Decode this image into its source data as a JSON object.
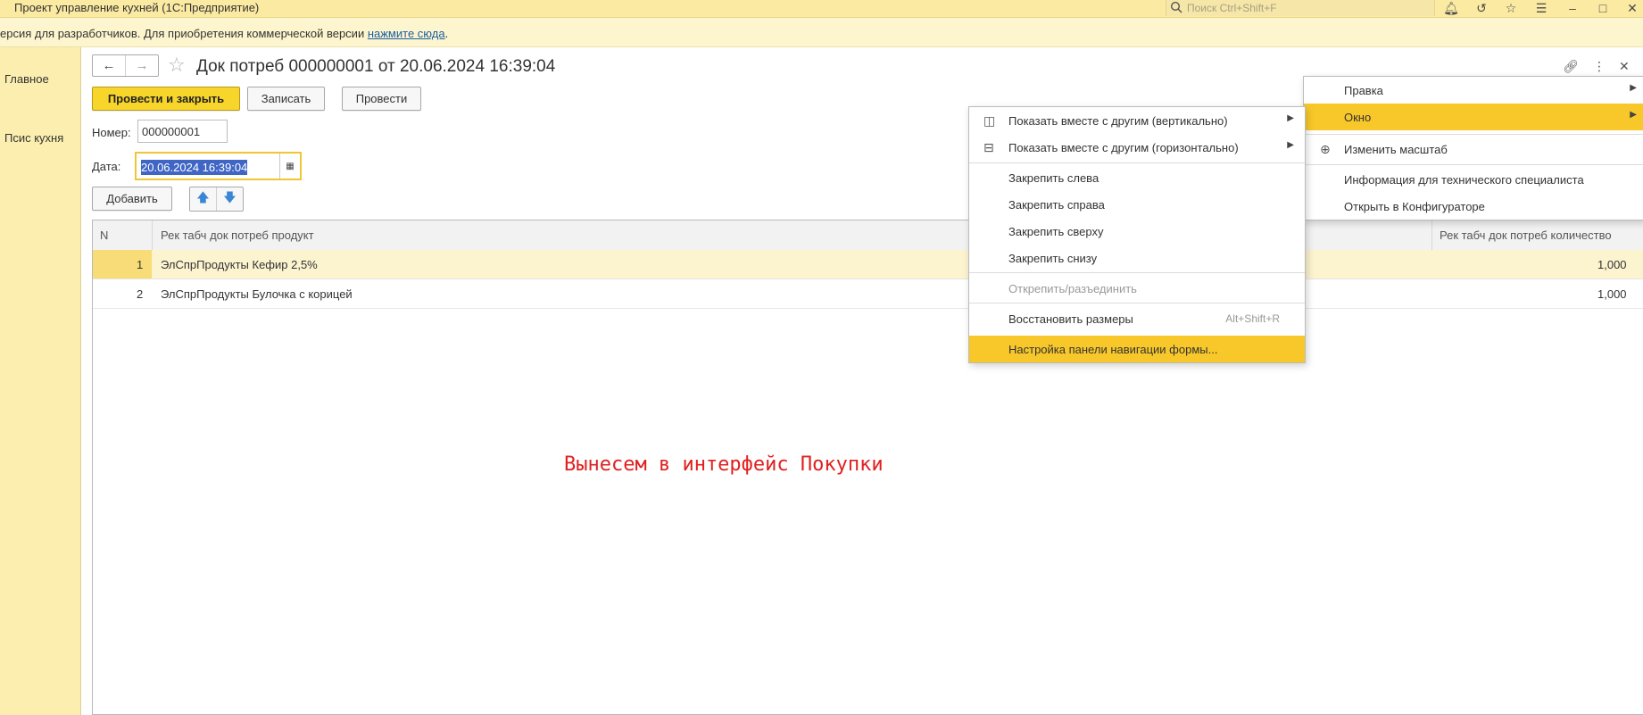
{
  "app": {
    "title": "Проект управление кухней  (1С:Предприятие)",
    "search_placeholder": "Поиск Ctrl+Shift+F"
  },
  "infobar": {
    "text": "ерсия для разработчиков. Для приобретения коммерческой версии ",
    "link": "нажмите сюда",
    "suffix": "."
  },
  "leftnav": {
    "items": [
      "Главное",
      "Псис кухня"
    ]
  },
  "form": {
    "title": "Док потреб 000000001 от 20.06.2024 16:39:04",
    "buttons": {
      "post_close": "Провести и закрыть",
      "save": "Записать",
      "post": "Провести",
      "add": "Добавить"
    },
    "number_label": "Номер:",
    "number_value": "000000001",
    "date_label": "Дата:",
    "date_value": "20.06.2024 16:39:04"
  },
  "table": {
    "columns": [
      "N",
      "Рек табч док потреб продукт",
      "Рек табч док потреб количество"
    ],
    "rows": [
      {
        "n": "1",
        "product": "ЭлСпрПродукты Кефир 2,5%",
        "qty": "1,000"
      },
      {
        "n": "2",
        "product": "ЭлСпрПродукты Булочка с корицей",
        "qty": "1,000"
      }
    ]
  },
  "annotation": "Вынесем в интерфейс Покупки",
  "main_menu": {
    "items": [
      "Правка",
      "Окно",
      "Изменить масштаб",
      "Информация для технического специалиста",
      "Открыть в Конфигураторе"
    ]
  },
  "window_submenu": {
    "items": [
      "Показать вместе с другим (вертикально)",
      "Показать вместе с другим (горизонтально)",
      "Закрепить слева",
      "Закрепить справа",
      "Закрепить сверху",
      "Закрепить снизу",
      "Открепить/разъединить",
      "Восстановить размеры",
      "Настройка панели навигации формы..."
    ],
    "restore_shortcut": "Alt+Shift+R"
  },
  "colors": {
    "accent": "#f8c82a",
    "titlebar": "#fbeaa2",
    "annotation": "#e02020"
  }
}
